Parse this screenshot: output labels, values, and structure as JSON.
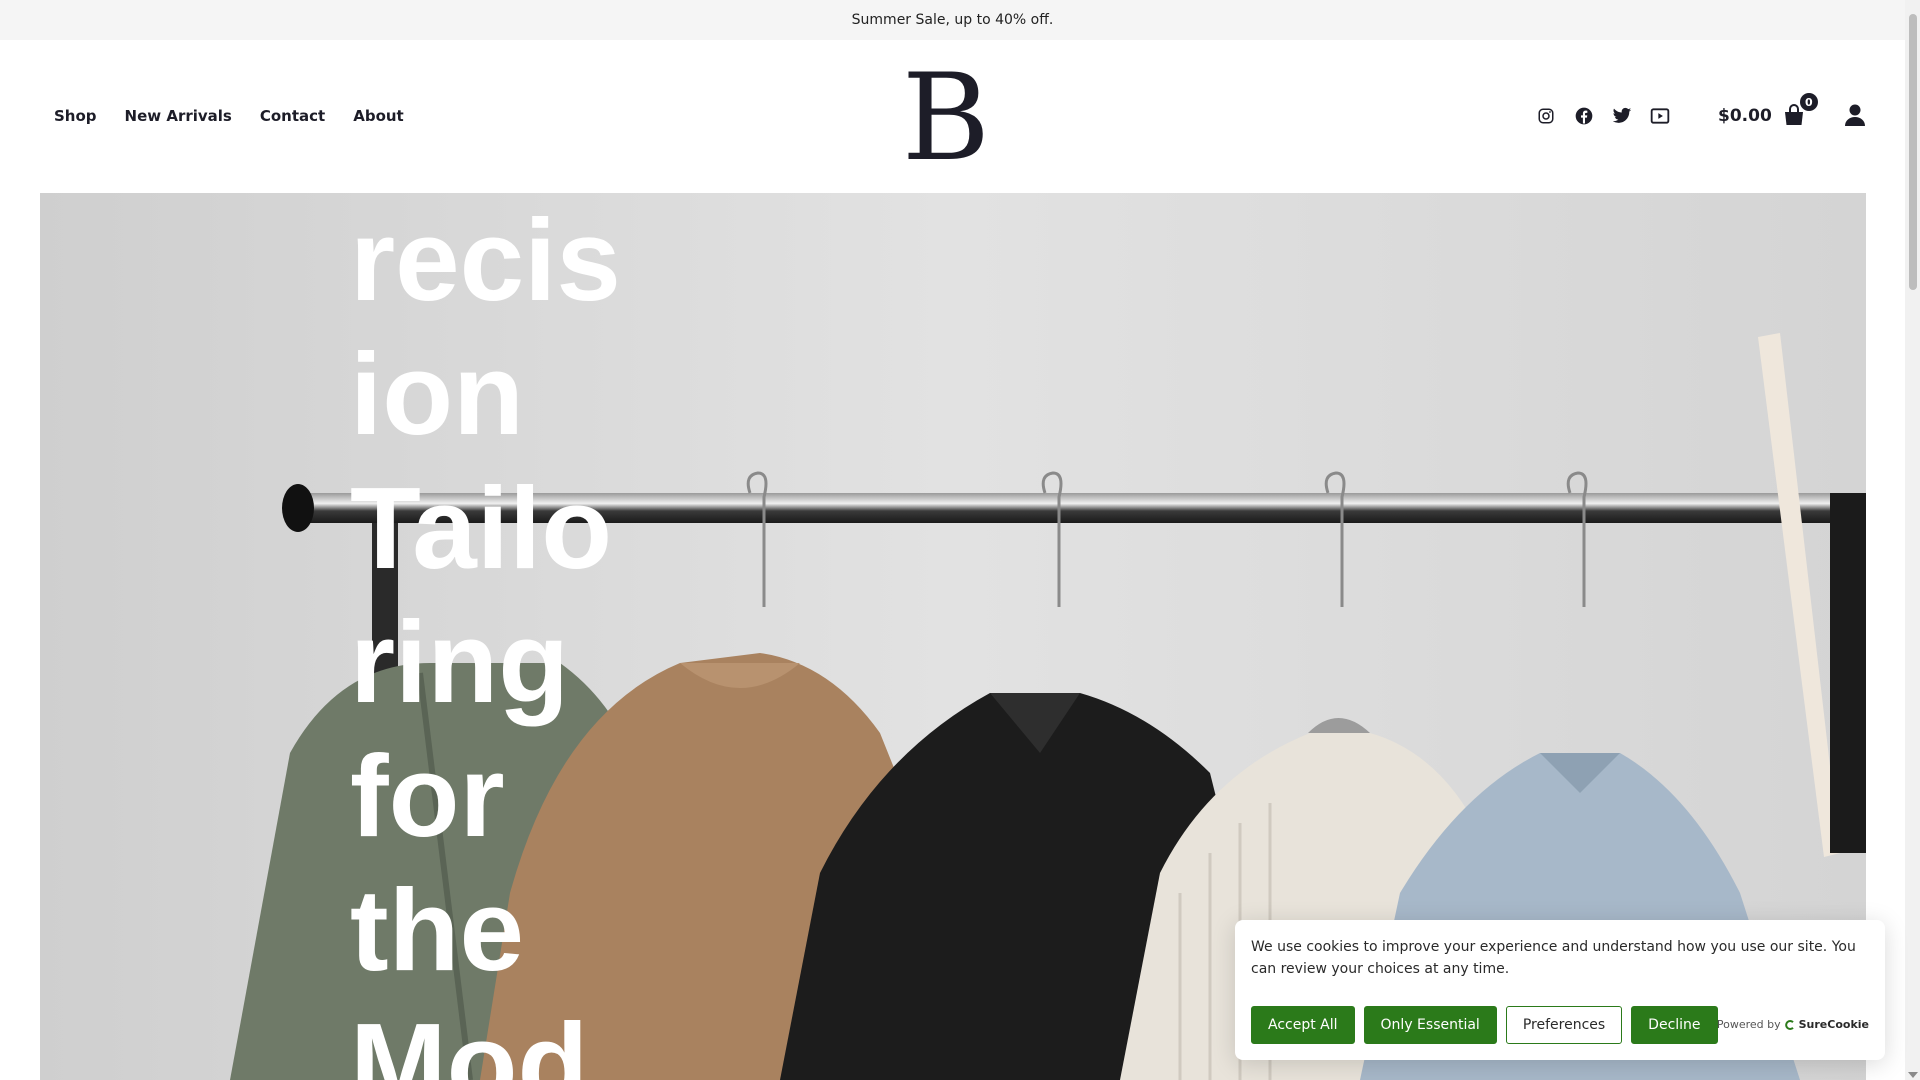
{
  "announcement": "Summer Sale, up to 40% off.",
  "nav": {
    "items": [
      {
        "label": "Shop"
      },
      {
        "label": "New Arrivals"
      },
      {
        "label": "Contact"
      },
      {
        "label": "About"
      }
    ]
  },
  "brand": {
    "logo_letter": "B"
  },
  "social": [
    "instagram-icon",
    "facebook-icon",
    "twitter-icon",
    "youtube-icon"
  ],
  "cart": {
    "total": "$0.00",
    "count": "0"
  },
  "hero": {
    "title_lines": [
      "recis",
      "ion",
      "Tailo",
      "ring",
      "for",
      "the",
      "Mod"
    ]
  },
  "cookie": {
    "message": "We use cookies to improve your experience and understand how you use our site. You can review your choices at any time.",
    "accept_all": "Accept All",
    "only_essential": "Only Essential",
    "preferences": "Preferences",
    "decline": "Decline",
    "powered_by": "Powered by",
    "provider": "SureCookie"
  },
  "colors": {
    "primary_text": "#1d1d28",
    "cookie_green": "#2b7a1a",
    "announcement_bg": "#f5f5f5"
  }
}
